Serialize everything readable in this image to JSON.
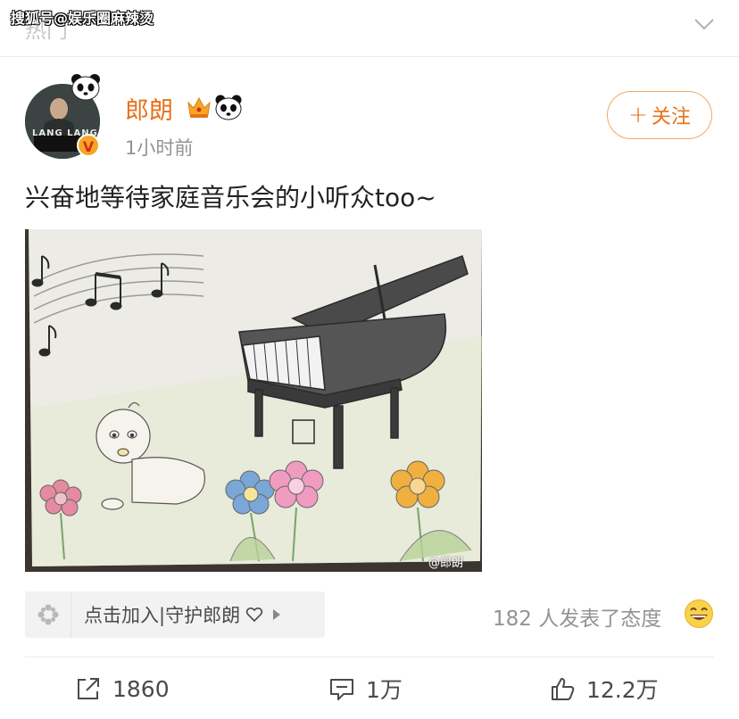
{
  "header": {
    "hot_label": "热门",
    "watermark": "搜狐号@娱乐圈麻辣烫"
  },
  "post": {
    "username": "郎朗",
    "time": "1小时前",
    "follow_label": "关注",
    "text": "兴奋地等待家庭音乐会的小听众too~",
    "avatar_text": "LANG LANG",
    "verified_badge": "V",
    "image_watermark": "@郎朗",
    "image_description_icons": [
      "crown-icon",
      "panda-icon"
    ]
  },
  "fan_bar": {
    "label": "点击加入|守护郎朗"
  },
  "attitude": {
    "text": "182 人发表了态度"
  },
  "actions": {
    "repost": "1860",
    "comment": "1万",
    "like": "12.2万"
  },
  "colors": {
    "accent": "#e8711a",
    "follow_border": "#f0a86a",
    "muted": "#939393"
  }
}
